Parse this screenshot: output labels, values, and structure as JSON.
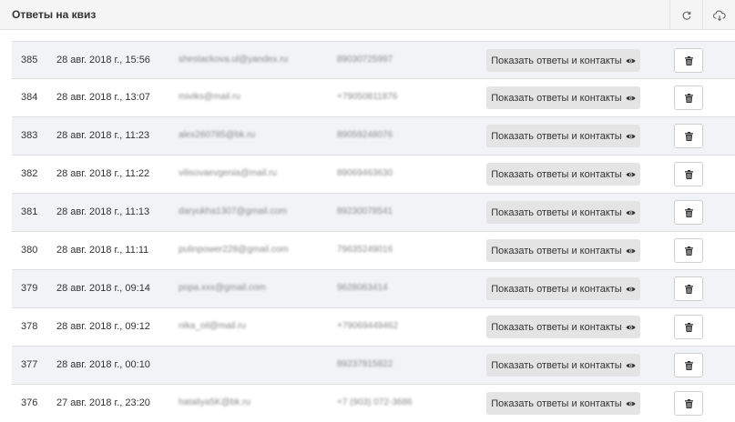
{
  "header": {
    "title": "Ответы на квиз",
    "refresh_icon": "refresh-icon",
    "download_icon": "cloud-download-icon"
  },
  "row_button_label": "Показать ответы и контакты",
  "row_button_icon": "eye-icon",
  "delete_icon": "trash-icon",
  "rows": [
    {
      "id": "385",
      "date": "28 авг. 2018 г., 15:56",
      "email": "shestackova.ul@yandex.ru",
      "phone": "89030725997"
    },
    {
      "id": "384",
      "date": "28 авг. 2018 г., 13:07",
      "email": "miviks@mail.ru",
      "phone": "+79050811876"
    },
    {
      "id": "383",
      "date": "28 авг. 2018 г., 11:23",
      "email": "alex260785@bk.ru",
      "phone": "89059248076"
    },
    {
      "id": "382",
      "date": "28 авг. 2018 г., 11:22",
      "email": "vilisovaevgenia@mail.ru",
      "phone": "89069463630"
    },
    {
      "id": "381",
      "date": "28 авг. 2018 г., 11:13",
      "email": "daryukha1307@gmail.com",
      "phone": "89230078541"
    },
    {
      "id": "380",
      "date": "28 авг. 2018 г., 11:11",
      "email": "pulinpower228@gmail.com",
      "phone": "79635249016"
    },
    {
      "id": "379",
      "date": "28 авг. 2018 г., 09:14",
      "email": "popa.xxx@gmail.com",
      "phone": "9628063414"
    },
    {
      "id": "378",
      "date": "28 авг. 2018 г., 09:12",
      "email": "nika_oil@mail.ru",
      "phone": "+79069449462"
    },
    {
      "id": "377",
      "date": "28 авг. 2018 г., 00:10",
      "email": "",
      "phone": "89237915822"
    },
    {
      "id": "376",
      "date": "27 авг. 2018 г., 23:20",
      "email": "hataliya5K@bk.ru",
      "phone": "+7 (903) 072-3686"
    }
  ]
}
